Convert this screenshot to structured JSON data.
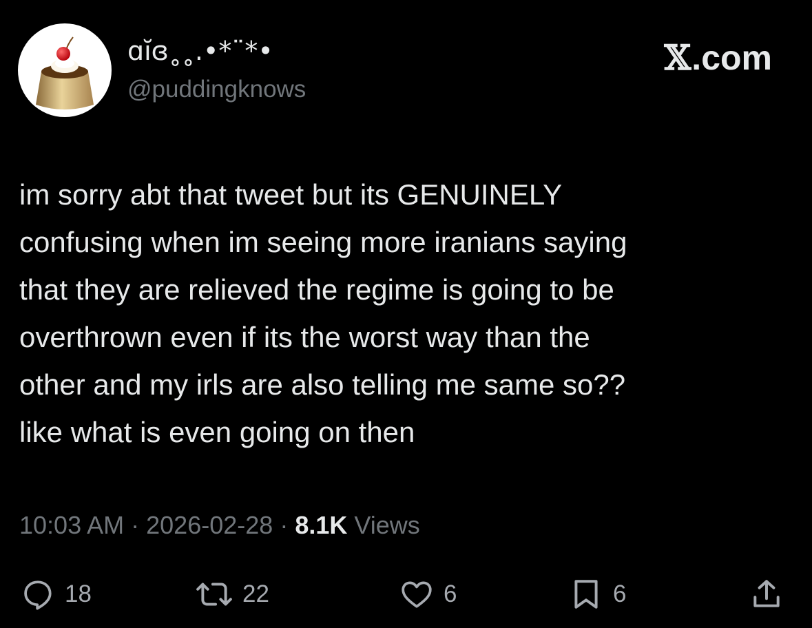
{
  "header": {
    "display_name": "ɑĭɞ˳˳.•*¨*•",
    "handle": "@puddingknows",
    "brand": {
      "x_letter": "𝕏",
      "suffix": ".com"
    },
    "avatar_icon": "pudding-icon"
  },
  "tweet": {
    "lines": [
      "im sorry abt that tweet but its GENUINELY",
      "confusing when im seeing more iranians saying",
      "that they are relieved the regime is going to be",
      "overthrown even if its the worst way than the",
      "other and my irls are also telling me same so??",
      "like what is even going on then"
    ]
  },
  "meta": {
    "time": "10:03 AM",
    "separator": "·",
    "date": "2026-02-28",
    "views_count": "8.1K",
    "views_label": "Views"
  },
  "actions": {
    "reply": {
      "icon": "reply-icon",
      "count": "18"
    },
    "repost": {
      "icon": "repost-icon",
      "count": "22"
    },
    "like": {
      "icon": "heart-icon",
      "count": "6"
    },
    "bookmark": {
      "icon": "bookmark-icon",
      "count": "6"
    },
    "share": {
      "icon": "share-icon"
    }
  },
  "colors": {
    "background": "#000000",
    "text_primary": "#e7e9ea",
    "text_secondary": "#71767b",
    "icon": "#a6aab0"
  }
}
